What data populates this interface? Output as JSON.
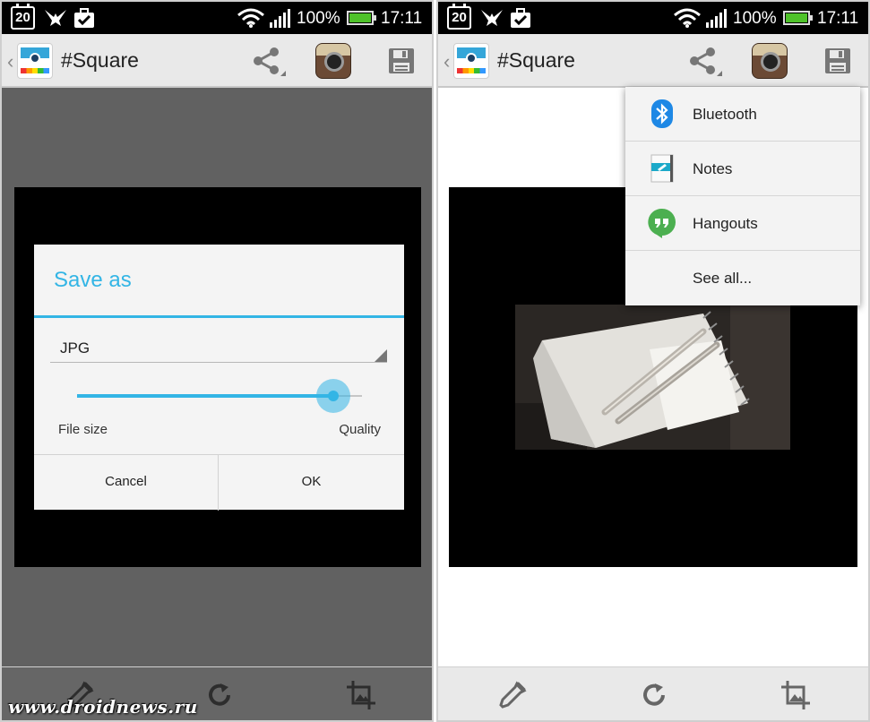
{
  "status_bar": {
    "date_badge": "20",
    "battery_percent": "100%",
    "time": "17:11"
  },
  "app": {
    "title": "#Square",
    "icons": {
      "back": "chevron-left-icon",
      "share": "share-icon",
      "instagram": "instagram-icon",
      "save": "floppy-disk-icon"
    }
  },
  "save_dialog": {
    "title": "Save as",
    "format": "JPG",
    "slider": {
      "min_label": "File size",
      "max_label": "Quality",
      "value_fraction": 0.9
    },
    "cancel_label": "Cancel",
    "ok_label": "OK"
  },
  "share_menu": {
    "items": [
      {
        "label": "Bluetooth",
        "icon": "bluetooth-icon"
      },
      {
        "label": "Notes",
        "icon": "notes-icon"
      },
      {
        "label": "Hangouts",
        "icon": "hangouts-icon"
      },
      {
        "label": "See all...",
        "icon": ""
      }
    ]
  },
  "bottom_toolbar": [
    "eyedropper-icon",
    "rotate-icon",
    "crop-icon"
  ],
  "colors": {
    "accent": "#33b5e5",
    "battery": "#4fc22a",
    "hangouts": "#4caf50",
    "bluetooth": "#1e88e5"
  },
  "watermark": "www.droidnews.ru"
}
